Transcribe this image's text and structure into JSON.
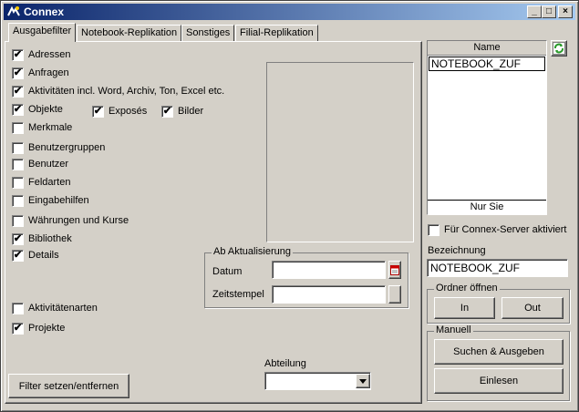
{
  "window": {
    "title": "Connex"
  },
  "tabs": [
    {
      "label": "Ausgabefilter"
    },
    {
      "label": "Notebook-Replikation"
    },
    {
      "label": "Sonstiges"
    },
    {
      "label": "Filial-Replikation"
    }
  ],
  "filters": {
    "adressen": {
      "label": "Adressen",
      "checked": true
    },
    "anfragen": {
      "label": "Anfragen",
      "checked": true
    },
    "aktivitaeten": {
      "label": "Aktivitäten incl. Word, Archiv, Ton, Excel etc.",
      "checked": true
    },
    "objekte": {
      "label": "Objekte",
      "checked": true
    },
    "exposes": {
      "label": "Exposés",
      "checked": true
    },
    "bilder": {
      "label": "Bilder",
      "checked": true
    },
    "merkmale": {
      "label": "Merkmale",
      "checked": false
    },
    "benutzergruppen": {
      "label": "Benutzergruppen",
      "checked": false
    },
    "benutzer": {
      "label": "Benutzer",
      "checked": false
    },
    "feldarten": {
      "label": "Feldarten",
      "checked": false
    },
    "eingabehilfen": {
      "label": "Eingabehilfen",
      "checked": false
    },
    "waehrungen": {
      "label": "Währungen und Kurse",
      "checked": false
    },
    "bibliothek": {
      "label": "Bibliothek",
      "checked": true
    },
    "details": {
      "label": "Details",
      "checked": true
    },
    "aktivitaetenarten": {
      "label": "Aktivitätenarten",
      "checked": false
    },
    "projekte": {
      "label": "Projekte",
      "checked": true
    }
  },
  "ab_aktualisierung": {
    "title": "Ab Aktualisierung",
    "datum_label": "Datum",
    "datum_value": "",
    "zeitstempel_label": "Zeitstempel",
    "zeitstempel_value": ""
  },
  "abteilung": {
    "label": "Abteilung",
    "value": ""
  },
  "filter_button": "Filter setzen/entfernen",
  "name_list": {
    "header": "Name",
    "items": [
      "NOTEBOOK_ZUF"
    ],
    "footer": "Nur Sie"
  },
  "server_checkbox": {
    "label": "Für Connex-Server aktiviert",
    "checked": false
  },
  "bezeichnung": {
    "label": "Bezeichnung",
    "value": "NOTEBOOK_ZUF"
  },
  "ordner": {
    "title": "Ordner öffnen",
    "in_label": "In",
    "out_label": "Out"
  },
  "manuell": {
    "title": "Manuell",
    "suchen_label": "Suchen & Ausgeben",
    "einlesen_label": "Einlesen"
  },
  "colors": {
    "title_start": "#0a246a",
    "title_end": "#a6caf0",
    "face": "#d4d0c8"
  }
}
